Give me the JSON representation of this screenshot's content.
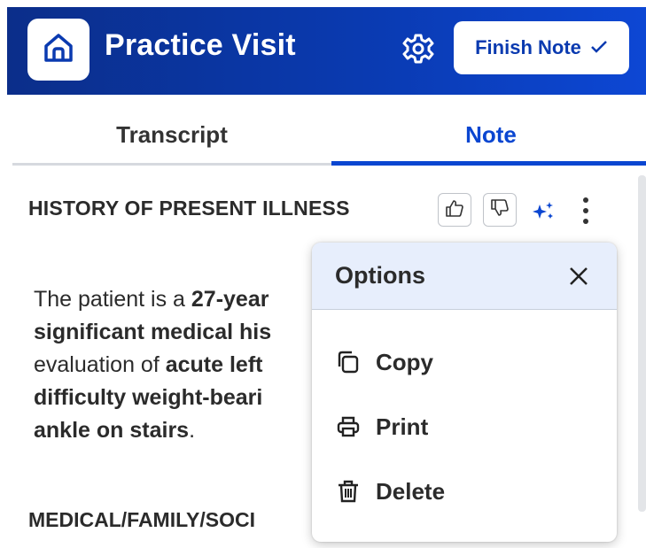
{
  "header": {
    "title": "Practice Visit",
    "finish_label": "Finish Note",
    "home_icon": "home-icon",
    "settings_icon": "gear-icon",
    "colors": {
      "primary": "#0a3ab0",
      "accent": "#0a46d1"
    }
  },
  "tabs": [
    {
      "label": "Transcript",
      "active": false
    },
    {
      "label": "Note",
      "active": true
    }
  ],
  "section": {
    "title": "HISTORY OF PRESENT ILLNESS",
    "paragraph": [
      {
        "text": "The patient is a ",
        "bold": false
      },
      {
        "text": "27-year",
        "bold": true
      },
      {
        "text": " ",
        "bold": false
      },
      {
        "text": "significant medical his",
        "bold": true
      },
      {
        "text": " evaluation of ",
        "bold": false
      },
      {
        "text": "acute left",
        "bold": true
      },
      {
        "text": " ",
        "bold": false
      },
      {
        "text": "difficulty weight-beari",
        "bold": true
      },
      {
        "text": " ",
        "bold": false
      },
      {
        "text": "ankle on stairs",
        "bold": true
      },
      {
        "text": ".",
        "bold": false
      }
    ]
  },
  "section2": {
    "title": "MEDICAL/FAMILY/SOCI"
  },
  "options_menu": {
    "title": "Options",
    "items": [
      {
        "label": "Copy",
        "icon": "copy-icon"
      },
      {
        "label": "Print",
        "icon": "print-icon"
      },
      {
        "label": "Delete",
        "icon": "trash-icon"
      }
    ]
  }
}
